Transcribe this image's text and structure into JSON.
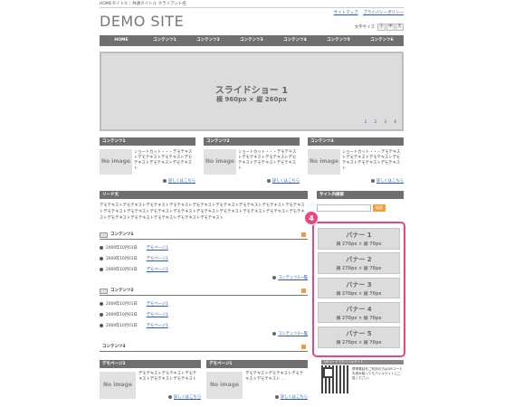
{
  "header": {
    "breadcrumb": "HOMEタイトル｜共通タイトル クライアント名",
    "links": [
      "サイトマップ",
      "プライバシーポリシー"
    ],
    "logo": "DEMO SITE",
    "font_size_label": "文字サイズ",
    "font_sizes": [
      "小",
      "中",
      "大"
    ]
  },
  "nav": [
    "HOME",
    "コンテンツ1",
    "コンテンツ2",
    "コンテンツ3",
    "コンテンツ4",
    "コンテンツ5",
    "コンテンツ6"
  ],
  "slideshow": {
    "title": "スライドショー 1",
    "size": "横 960px × 縦 260px",
    "pages": [
      "1",
      "2",
      "3",
      "4"
    ]
  },
  "content_blocks": [
    {
      "title": "コンテンツ1",
      "image": "No image",
      "text": "ショートカット・・・デモテキストデモテキストデモテキストデモテキストデモテキストデモテキスト",
      "more": "詳しくはこちら"
    },
    {
      "title": "コンテンツ2",
      "image": "No image",
      "text": "ショートカット・・・デモテキストデモテキストデモテキストデモテキストデモテキストデモテキスト",
      "more": "詳しくはこちら"
    },
    {
      "title": "コンテンツ3",
      "image": "No image",
      "text": "ショートカット・・・デモテキストデモテキストデモテキストデモテキストデモテキストデモテキスト",
      "more": "詳しくはこちら"
    }
  ],
  "lead": {
    "title": "リード文",
    "text": "デモテキストデモテキストデモテキストデモテキストデモテキストデモテキストデモテキストデモテキストデモテキストデモテキストデモテキストデモテキストデモテキストデモテキストデモテキストデモテキストデモテキストデモテキストデモテキストデモテキストデモテキストデモテキストデモテキスト"
  },
  "news_sections": [
    {
      "title": "コンテンツ1",
      "items": [
        {
          "date": "2009年10月01日",
          "link": "デモページ1"
        },
        {
          "date": "2009年10月01日",
          "link": "デモページ1"
        },
        {
          "date": "2009年10月01日",
          "link": "デモページ1"
        }
      ],
      "list_link": "コンテンツ1一覧"
    },
    {
      "title": "コンテンツ2",
      "items": [
        {
          "date": "2009年10月01日",
          "link": "デモページ1"
        },
        {
          "date": "2009年10月01日",
          "link": "デモページ1"
        },
        {
          "date": "2009年10月01日",
          "link": "デモページ1"
        }
      ],
      "list_link": "コンテンツ2一覧"
    },
    {
      "title": "コンテンツ3"
    }
  ],
  "bottom_blocks": [
    {
      "title": "デモページ2",
      "image": "No image",
      "text": "デモテキストデモテキストデモテキストデモテキストデモテキスト",
      "more": "詳しくはこちら"
    },
    {
      "title": "デモページ1",
      "image": "No image",
      "text": "デモテキストデモテキストデモテキストデモテキスト ...",
      "more": "詳しくはこちら"
    }
  ],
  "sidebar": {
    "search_title": "サイト内検索",
    "search_button": "検索",
    "badge": "4",
    "banners": [
      {
        "title": "バナー 1",
        "size": "横 270px × 縦 70px"
      },
      {
        "title": "バナー 2",
        "size": "横 270px × 縦 70px"
      },
      {
        "title": "バナー 3",
        "size": "横 270px × 縦 70px"
      },
      {
        "title": "バナー 4",
        "size": "横 270px × 縦 70px"
      },
      {
        "title": "バナー 5",
        "size": "横 270px × 縦 70px"
      }
    ],
    "qr_title": "QRコードでモバイルサイト",
    "qr_text": "携帯電話をご利用の方はQRコードを読み取ってモバイルサイトにご覧ください。"
  },
  "colors": {
    "nav_bg": "#6f6f6f",
    "highlight": "#e8487c",
    "link": "#2a5db0",
    "rss": "#f59a3b"
  }
}
